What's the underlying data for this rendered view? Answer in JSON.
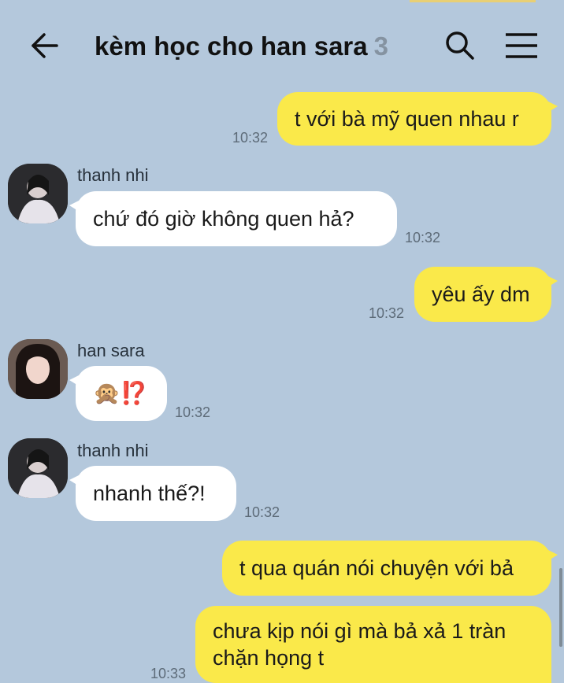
{
  "header": {
    "back_icon": "arrow-left-icon",
    "title": "kèm học cho han sara",
    "member_count": "3",
    "search_icon": "search-icon",
    "menu_icon": "hamburger-menu-icon"
  },
  "colors": {
    "background": "#b4c8dc",
    "my_bubble": "#fae94a",
    "their_bubble": "#ffffff",
    "timestamp": "#5d6b78"
  },
  "messages": [
    {
      "from": "me",
      "text": "t với bà mỹ quen nhau r",
      "time": "10:32"
    },
    {
      "from": "thanh nhi",
      "sender": "thanh nhi",
      "text": "chứ đó giờ không quen hả?",
      "time": "10:32"
    },
    {
      "from": "me",
      "text": "yêu ấy dm",
      "time": "10:32"
    },
    {
      "from": "han sara",
      "sender": "han sara",
      "text": "🙊⁉️",
      "time": "10:32"
    },
    {
      "from": "thanh nhi",
      "sender": "thanh nhi",
      "text": "nhanh thế?!",
      "time": "10:32"
    },
    {
      "from": "me",
      "text": "t qua quán nói chuyện với bả",
      "time": ""
    },
    {
      "from": "me",
      "text_line1": "chưa kịp nói gì mà bả xả 1 tràn",
      "text_line2": "chặn họng t",
      "time": "10:33"
    }
  ]
}
